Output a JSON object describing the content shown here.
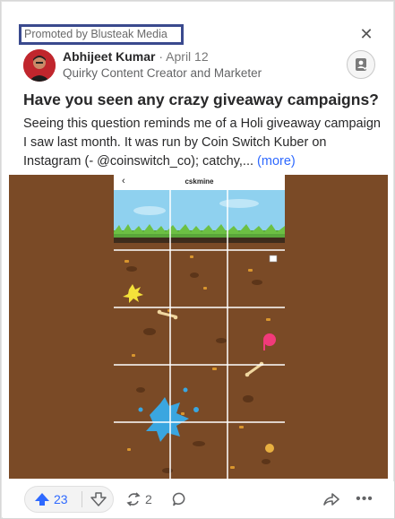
{
  "promo_label": "Promoted by Blusteak Media",
  "close_icon": "close-icon",
  "author": {
    "name": "Abhijeet Kumar",
    "separator": "·",
    "date": "April 12",
    "credential": "Quirky Content Creator and Marketer"
  },
  "follow_icon": "follow-user-icon",
  "question": "Have you seen any crazy giveaway campaigns?",
  "body_text": "Seeing this question reminds me of a Holi giveaway campaign I saw last month. It was run by Coin Switch Kuber on Instagram (- @coinswitch_co); catchy,...",
  "more_label": "(more)",
  "media": {
    "phone_title": "cskmine",
    "back_icon": "back-arrow-icon"
  },
  "footer": {
    "upvote_count": "23",
    "share_count": "2",
    "upvote_icon": "upvote-arrow-icon",
    "downvote_icon": "downvote-arrow-icon",
    "share_icon": "reshare-icon",
    "comment_icon": "comment-icon",
    "forward_icon": "share-forward-icon",
    "overflow_label": "•••"
  },
  "colors": {
    "accent": "#2e69ff",
    "promo_border": "#3a4a8e",
    "dirt": "#7a4a26",
    "sky": "#8fd1ef"
  }
}
